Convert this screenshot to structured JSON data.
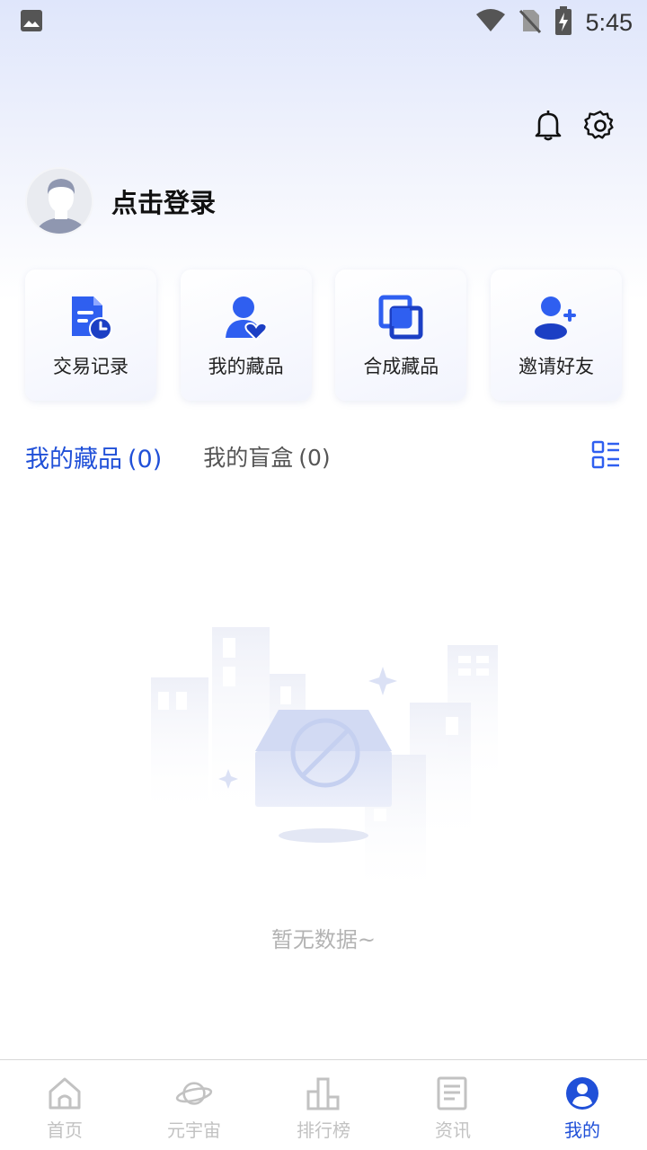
{
  "status_bar": {
    "time": "5:45",
    "icons": [
      "image-icon",
      "wifi-icon",
      "no-sim-icon",
      "battery-charging-icon"
    ]
  },
  "header": {
    "icons": [
      "bell-icon",
      "gear-icon"
    ]
  },
  "profile": {
    "login_label": "点击登录",
    "avatar_icon": "avatar-placeholder"
  },
  "quick_actions": [
    {
      "label": "交易记录",
      "icon": "transaction-record-icon"
    },
    {
      "label": "我的藏品",
      "icon": "my-collection-icon"
    },
    {
      "label": "合成藏品",
      "icon": "synthesize-icon"
    },
    {
      "label": "邀请好友",
      "icon": "invite-friend-icon"
    }
  ],
  "tabs": [
    {
      "label": "我的藏品",
      "count": "(0)",
      "active": true
    },
    {
      "label": "我的盲盒",
      "count": "(0)",
      "active": false
    }
  ],
  "view_toggle_icon": "list-view-icon",
  "empty_state": {
    "text": "暂无数据~"
  },
  "bottom_nav": [
    {
      "label": "首页",
      "icon": "home-icon",
      "active": false
    },
    {
      "label": "元宇宙",
      "icon": "planet-icon",
      "active": false
    },
    {
      "label": "排行榜",
      "icon": "ranking-icon",
      "active": false
    },
    {
      "label": "资讯",
      "icon": "news-icon",
      "active": false
    },
    {
      "label": "我的",
      "icon": "profile-icon",
      "active": true
    }
  ],
  "colors": {
    "accent": "#2050d8",
    "inactive_nav": "#c2c2c2",
    "empty_text": "#b3b3b3"
  }
}
